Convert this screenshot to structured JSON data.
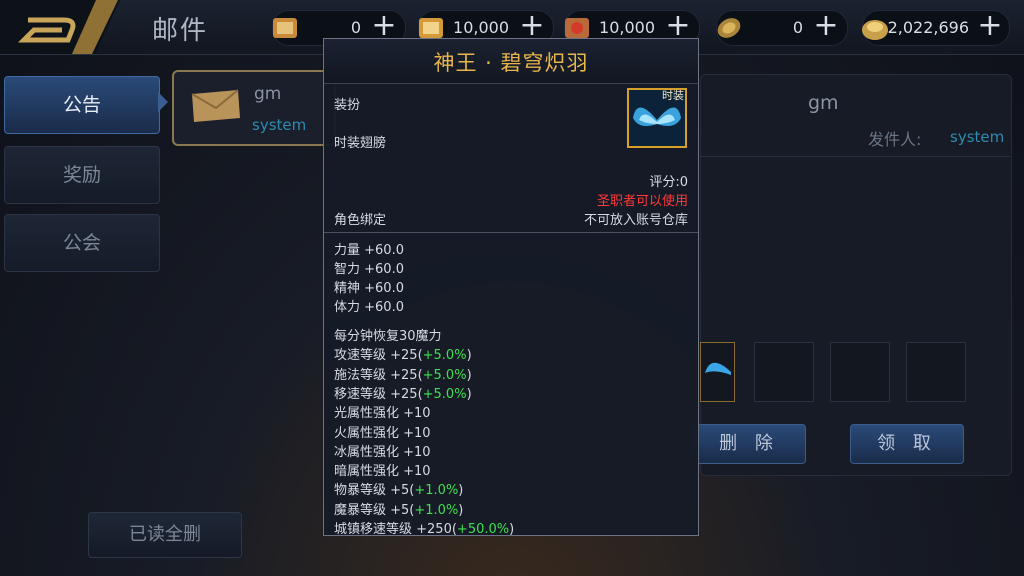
{
  "header": {
    "title": "邮件"
  },
  "currencies": [
    {
      "icon": "scroll-ticket-icon",
      "value": "0"
    },
    {
      "icon": "scroll-gold-icon",
      "value": "10,000"
    },
    {
      "icon": "scroll-red-icon",
      "value": "10,000"
    },
    {
      "icon": "coin-icon",
      "value": "0"
    },
    {
      "icon": "gold-bag-icon",
      "value": "2,022,696"
    }
  ],
  "tabs": [
    {
      "label": "公告",
      "active": true
    },
    {
      "label": "奖励",
      "active": false
    },
    {
      "label": "公会",
      "active": false
    }
  ],
  "mail_list": [
    {
      "from": "gm",
      "sender": "system"
    }
  ],
  "buttons": {
    "delete_read": "已读全删",
    "delete": "删 除",
    "claim": "领 取"
  },
  "detail": {
    "title": "gm",
    "sender_label": "发件人:",
    "sender": "system"
  },
  "tooltip": {
    "name": "神王 · 碧穹炽羽",
    "category": "装扮",
    "subcategory": "时装翅膀",
    "icon_label": "时装",
    "score": "评分:0",
    "class_restriction": "圣职者可以使用",
    "binding": "角色绑定",
    "storage_note": "不可放入账号仓库",
    "base_stats": [
      "力量 +60.0",
      "智力 +60.0",
      "精神 +60.0",
      "体力 +60.0"
    ],
    "extra_stats": [
      {
        "text": "每分钟恢复30魔力",
        "bonus": ""
      },
      {
        "text": "攻速等级 +25(",
        "bonus": "+5.0%",
        "tail": ")"
      },
      {
        "text": "施法等级 +25(",
        "bonus": "+5.0%",
        "tail": ")"
      },
      {
        "text": "移速等级 +25(",
        "bonus": "+5.0%",
        "tail": ")"
      },
      {
        "text": "光属性强化 +10",
        "bonus": ""
      },
      {
        "text": "火属性强化 +10",
        "bonus": ""
      },
      {
        "text": "冰属性强化 +10",
        "bonus": ""
      },
      {
        "text": "暗属性强化 +10",
        "bonus": ""
      },
      {
        "text": "物暴等级 +5(",
        "bonus": "+1.0%",
        "tail": ")"
      },
      {
        "text": "魔暴等级 +5(",
        "bonus": "+1.0%",
        "tail": ")"
      },
      {
        "text": "城镇移速等级 +250(",
        "bonus": "+50.0%",
        "tail": ")"
      }
    ]
  },
  "colors": {
    "accent_gold": "#e8b64a",
    "restriction_red": "#ff3a3a",
    "bonus_green": "#3fe04f",
    "sender_blue": "#2f8ab0"
  }
}
